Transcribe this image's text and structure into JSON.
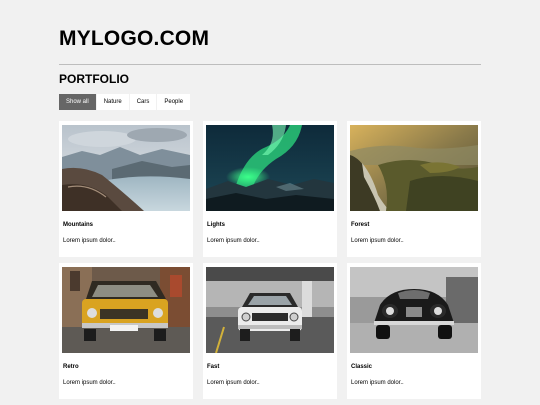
{
  "header": {
    "logo": "MYLOGO.COM"
  },
  "portfolio": {
    "title": "PORTFOLIO",
    "filters": [
      {
        "label": "Show all",
        "active": true
      },
      {
        "label": "Nature",
        "active": false
      },
      {
        "label": "Cars",
        "active": false
      },
      {
        "label": "People",
        "active": false
      }
    ],
    "items": [
      {
        "title": "Mountains",
        "text": "Lorem ipsum dolor..",
        "image": "mountains-lake-photo"
      },
      {
        "title": "Lights",
        "text": "Lorem ipsum dolor..",
        "image": "northern-lights-photo"
      },
      {
        "title": "Forest",
        "text": "Lorem ipsum dolor..",
        "image": "forest-hills-photo"
      },
      {
        "title": "Retro",
        "text": "Lorem ipsum dolor..",
        "image": "yellow-retro-car-photo"
      },
      {
        "title": "Fast",
        "text": "Lorem ipsum dolor..",
        "image": "white-muscle-car-photo"
      },
      {
        "title": "Classic",
        "text": "Lorem ipsum dolor..",
        "image": "black-classic-car-photo"
      }
    ]
  }
}
